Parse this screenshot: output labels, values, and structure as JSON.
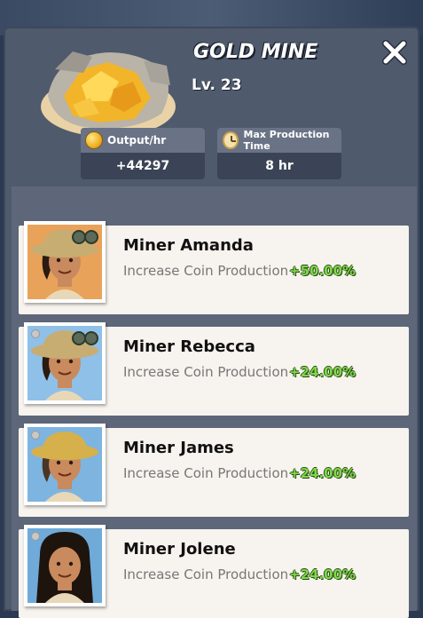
{
  "building": {
    "title": "GOLD MINE",
    "level": "Lv. 23"
  },
  "stats": [
    {
      "label": "Output/hr",
      "value": "+44297",
      "icon": "coin-icon"
    },
    {
      "label": "Max Production Time",
      "value": "8 hr",
      "icon": "clock-icon"
    }
  ],
  "miners": [
    {
      "name": "Miner Amanda",
      "desc": "Increase Coin Production",
      "bonus": "+50.00%",
      "portrait_bg": "#e9a25a",
      "hat": "#c7ad72",
      "goggles": true,
      "hair": "#2a1a12"
    },
    {
      "name": "Miner Rebecca",
      "desc": "Increase Coin Production",
      "bonus": "+24.00%",
      "portrait_bg": "#8fc0e8",
      "hat": "#c7ad72",
      "goggles": true,
      "hair": "#2a1a12"
    },
    {
      "name": "Miner James",
      "desc": "Increase Coin Production",
      "bonus": "+24.00%",
      "portrait_bg": "#7db4e0",
      "hat": "#d6b04a",
      "goggles": false,
      "hair": "#4a3525"
    },
    {
      "name": "Miner Jolene",
      "desc": "Increase Coin Production",
      "bonus": "+24.00%",
      "portrait_bg": "#6faad9",
      "hat": "none",
      "goggles": false,
      "hair": "#1e140e"
    }
  ]
}
